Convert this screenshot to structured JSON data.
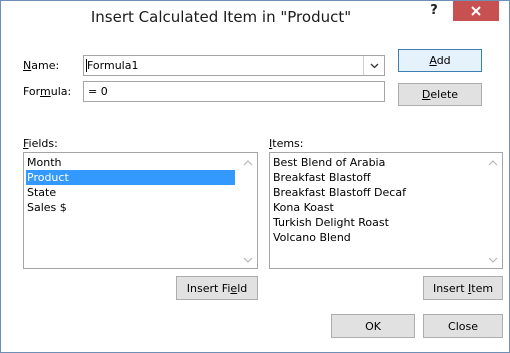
{
  "dialog": {
    "title": "Insert Calculated Item in \"Product\"",
    "help": "?"
  },
  "name": {
    "label_pre": "",
    "label_u": "N",
    "label_post": "ame:",
    "value": "Formula1"
  },
  "formula": {
    "label_pre": "For",
    "label_u": "m",
    "label_post": "ula:",
    "value": "= 0"
  },
  "fields": {
    "label_u": "F",
    "label_post": "ields:",
    "items": [
      "Month",
      "Product",
      "State",
      "Sales $"
    ],
    "selected": "Product"
  },
  "items": {
    "label_u": "I",
    "label_post": "tems:",
    "items": [
      "Best Blend of Arabia",
      "Breakfast Blastoff",
      "Breakfast Blastoff Decaf",
      "Kona Koast",
      "Turkish Delight Roast",
      "Volcano Blend"
    ]
  },
  "buttons": {
    "add_u": "A",
    "add_post": "dd",
    "delete_u": "D",
    "delete_post": "elete",
    "insert_field_pre": "Insert Fi",
    "insert_field_u": "e",
    "insert_field_post": "ld",
    "insert_item_pre": "Insert ",
    "insert_item_u": "I",
    "insert_item_post": "tem",
    "ok": "OK",
    "close": "Close"
  },
  "colors": {
    "close_button": "#c75050",
    "selection": "#3399ff",
    "default_button_border": "#3c7fb1"
  }
}
